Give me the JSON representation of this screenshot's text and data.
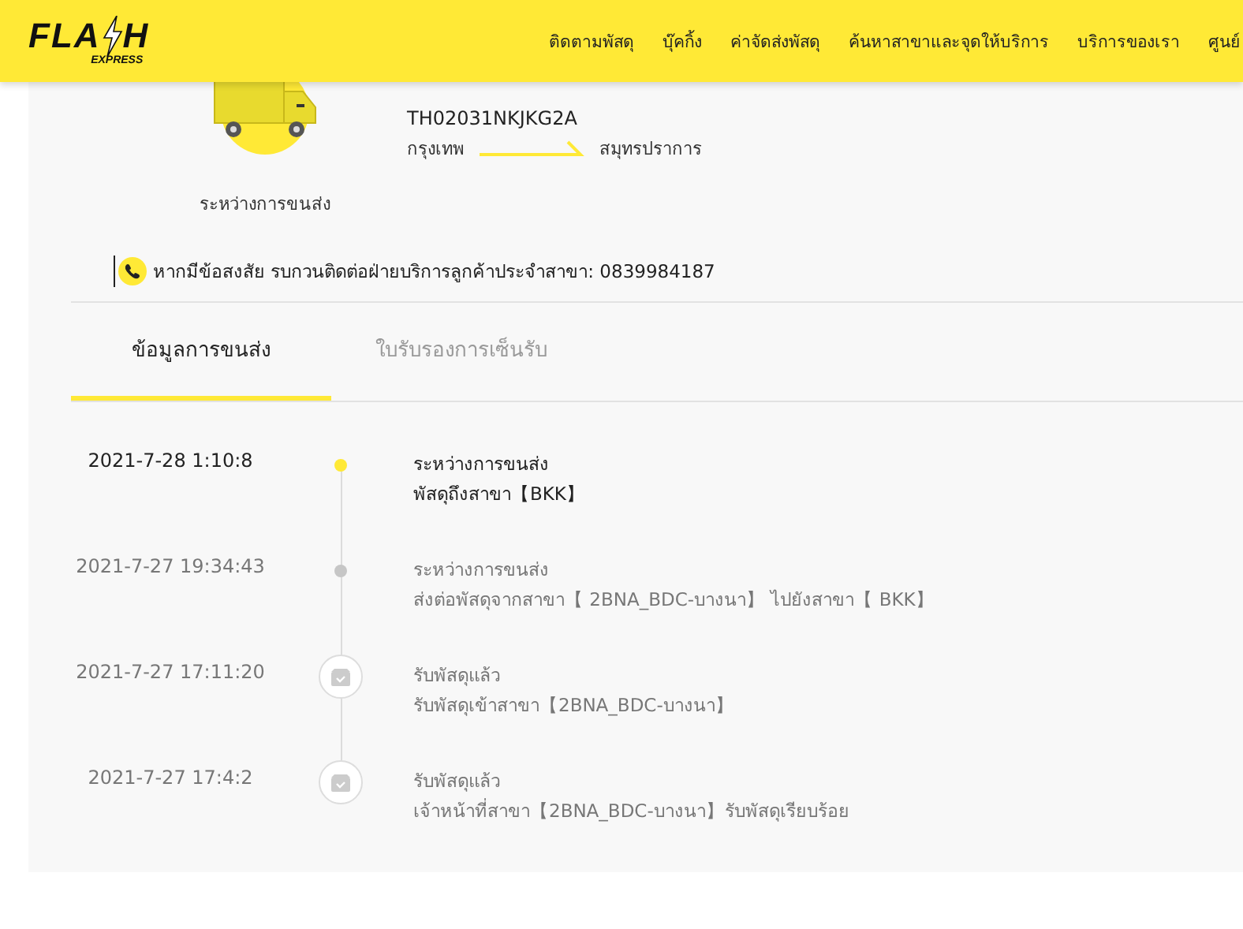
{
  "header": {
    "logo": {
      "left": "FLA",
      "right": "H",
      "subtitle": "EXPRESS"
    },
    "nav": [
      {
        "label": "ติดตามพัสดุ"
      },
      {
        "label": "บุ๊คกิ้ง"
      },
      {
        "label": "ค่าจัดส่งพัสดุ"
      },
      {
        "label": "ค้นหาสาขาและจุดให้บริการ"
      },
      {
        "label": "บริการของเรา"
      },
      {
        "label": "ศูนย์"
      }
    ]
  },
  "shipment": {
    "status": "ระหว่างการขนส่ง",
    "tracking_number": "TH02031NKJKG2A",
    "origin": "กรุงเทพ",
    "destination": "สมุทรปราการ"
  },
  "contact": {
    "text": "หากมีข้อสงสัย รบกวนติดต่อฝ่ายบริการลูกค้าประจำสาขา: 0839984187"
  },
  "tabs": [
    {
      "label": "ข้อมูลการขนส่ง",
      "selected": true
    },
    {
      "label": "ใบรับรองการเซ็นรับ",
      "selected": false
    }
  ],
  "timeline": [
    {
      "time": "2021-7-28 1:10:8",
      "kind": "dot",
      "current": true,
      "status": "ระหว่างการขนส่ง",
      "detail": "พัสดุถึงสาขา【BKK】"
    },
    {
      "time": "2021-7-27 19:34:43",
      "kind": "dot",
      "current": false,
      "status": "ระหว่างการขนส่ง",
      "detail": "ส่งต่อพัสดุจากสาขา【 2BNA_BDC-บางนา】 ไปยังสาขา【 BKK】"
    },
    {
      "time": "2021-7-27 17:11:20",
      "kind": "box",
      "current": false,
      "status": "รับพัสดุแล้ว",
      "detail": "รับพัสดุเข้าสาขา【2BNA_BDC-บางนา】"
    },
    {
      "time": "2021-7-27 17:4:2",
      "kind": "box",
      "current": false,
      "status": "รับพัสดุแล้ว",
      "detail": "เจ้าหน้าที่สาขา【2BNA_BDC-บางนา】รับพัสดุเรียบร้อย"
    }
  ]
}
